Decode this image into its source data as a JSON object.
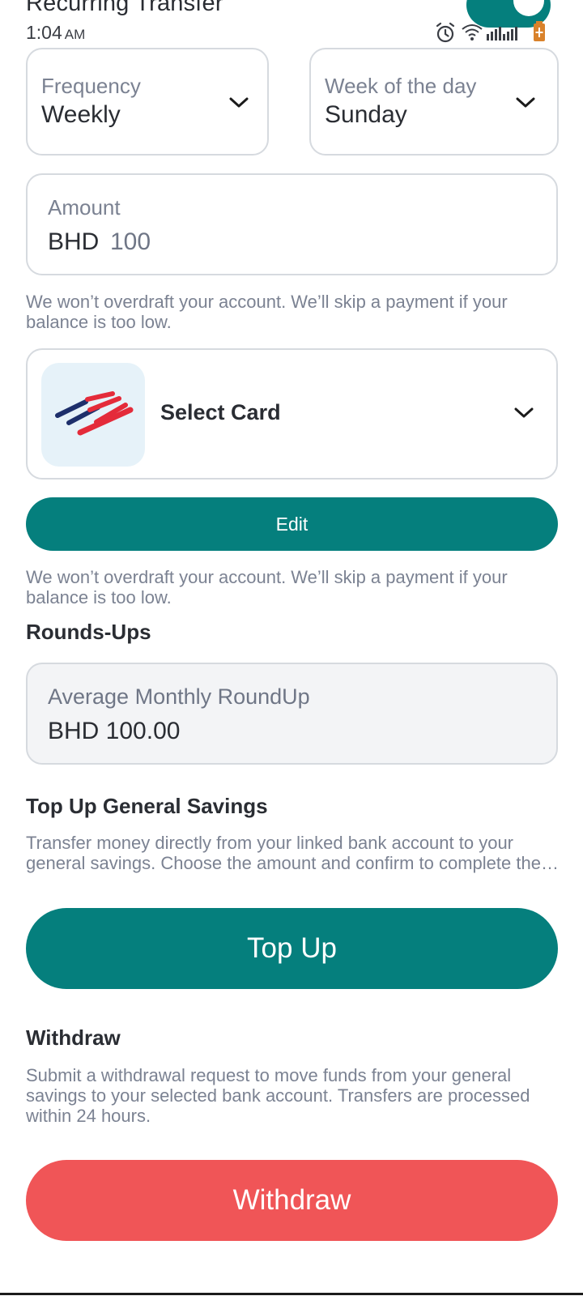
{
  "header": {
    "title": "Recurring Transfer",
    "toggle_on": true
  },
  "status_bar": {
    "time": "1:04",
    "ampm": "AM",
    "icons": [
      "alarm-icon",
      "wifi-icon",
      "signal-icon",
      "battery-icon"
    ]
  },
  "frequency": {
    "label": "Frequency",
    "value": "Weekly"
  },
  "week_day": {
    "label": "Week of the day",
    "value": "Sunday"
  },
  "amount": {
    "label": "Amount",
    "currency": "BHD",
    "value": "100"
  },
  "overdraft_note": "We won’t overdraft your account. We’ll skip a payment if your balance is too low.",
  "card": {
    "label": "Select Card",
    "logo_icon": "bank-flag-logo"
  },
  "edit_button": "Edit",
  "overdraft_note_2": "We won’t overdraft your account. We’ll skip a payment if your balance is too low.",
  "roundups": {
    "title": "Rounds-Ups",
    "label": "Average Monthly RoundUp",
    "value": "BHD 100.00"
  },
  "top_up": {
    "title": "Top Up General Savings",
    "description": "Transfer money directly from your linked bank account to your general savings. Choose the amount and confirm to complete the transfer.",
    "button": "Top Up"
  },
  "withdraw": {
    "title": "Withdraw",
    "description": "Submit a withdrawal request to move funds from your general savings to your selected bank account. Transfers are processed within 24 hours.",
    "button": "Withdraw"
  },
  "colors": {
    "primary": "#057f7d",
    "danger": "#f05557",
    "text": "#2a2d33",
    "muted": "#7b8292",
    "border": "#d6dadf",
    "logo_bg": "#e6f2f9"
  }
}
